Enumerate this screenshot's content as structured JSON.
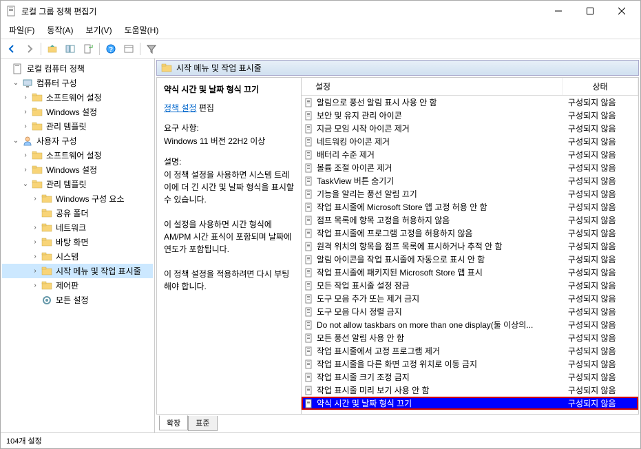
{
  "window": {
    "title": "로컬 그룹 정책 편집기"
  },
  "menu": {
    "file": "파일(F)",
    "action": "동작(A)",
    "view": "보기(V)",
    "help": "도움말(H)"
  },
  "tree": {
    "root": "로컬 컴퓨터 정책",
    "computer_config": "컴퓨터 구성",
    "software_settings_1": "소프트웨어 설정",
    "windows_settings_1": "Windows 설정",
    "admin_templates_1": "관리 템플릿",
    "user_config": "사용자 구성",
    "software_settings_2": "소프트웨어 설정",
    "windows_settings_2": "Windows 설정",
    "admin_templates_2": "관리 템플릿",
    "windows_components": "Windows 구성 요소",
    "shared_folders": "공유 폴더",
    "network": "네트워크",
    "desktop": "바탕 화면",
    "system": "시스템",
    "start_taskbar": "시작 메뉴 및 작업 표시줄",
    "control_panel": "제어판",
    "all_settings": "모든 설정"
  },
  "path_header": "시작 메뉴 및 작업 표시줄",
  "detail": {
    "title": "약식 시간 및 날짜 형식 끄기",
    "policy_link": "정책 설정",
    "edit_text": "편집",
    "req_label": "요구 사항:",
    "req_value": "Windows 11 버전 22H2 이상",
    "desc_label": "설명:",
    "desc_p1": "이 정책 설정을 사용하면 시스템 트레이에 더 긴 시간 및 날짜 형식을 표시할 수 있습니다.",
    "desc_p2": "이 설정을 사용하면 시간 형식에 AM/PM 시간 표식이 포함되며 날짜에 연도가 포함됩니다.",
    "desc_p3": "이 정책 설정을 적용하려면 다시 부팅해야 합니다."
  },
  "list": {
    "header_setting": "설정",
    "header_state": "상태",
    "state_not_configured": "구성되지 않음",
    "items": [
      "알림으로 풍선 알림 표시 사용 안 함",
      "보안 및 유지 관리 아이콘",
      "지금 모임 시작 아이콘 제거",
      "네트워킹 아이콘 제거",
      "배터리 수준 제거",
      "볼륨 조절 아이콘 제거",
      "TaskView 버튼 숨기기",
      "기능을 알리는 풍선 알림 끄기",
      "작업 표시줄에 Microsoft Store 앱 고정 허용 안 함",
      "점프 목록에 항목 고정을 허용하지 않음",
      "작업 표시줄에 프로그램 고정을 허용하지 않음",
      "원격 위치의 항목을 점프 목록에 표시하거나 추적 안 함",
      "알림 아이콘을 작업 표시줄에 자동으로 표시 안 함",
      "작업 표시줄에 패키지된 Microsoft Store 앱 표시",
      "모든 작업 표시줄 설정 잠금",
      "도구 모음 추가 또는 제거 금지",
      "도구 모음 다시 정렬 금지",
      "Do not allow taskbars on more than one display(둘 이상의...",
      "모든 풍선 알림 사용 안 함",
      "작업 표시줄에서 고정 프로그램 제거",
      "작업 표시줄을 다른 화면 고정 위치로 이동 금지",
      "작업 표시줄 크기 조정 금지",
      "작업 표시줄 미리 보기 사용 안 함",
      "약식 시간 및 날짜 형식 끄기"
    ],
    "selected_index": 23
  },
  "tabs": {
    "extended": "확장",
    "standard": "표준"
  },
  "statusbar": "104개 설정"
}
